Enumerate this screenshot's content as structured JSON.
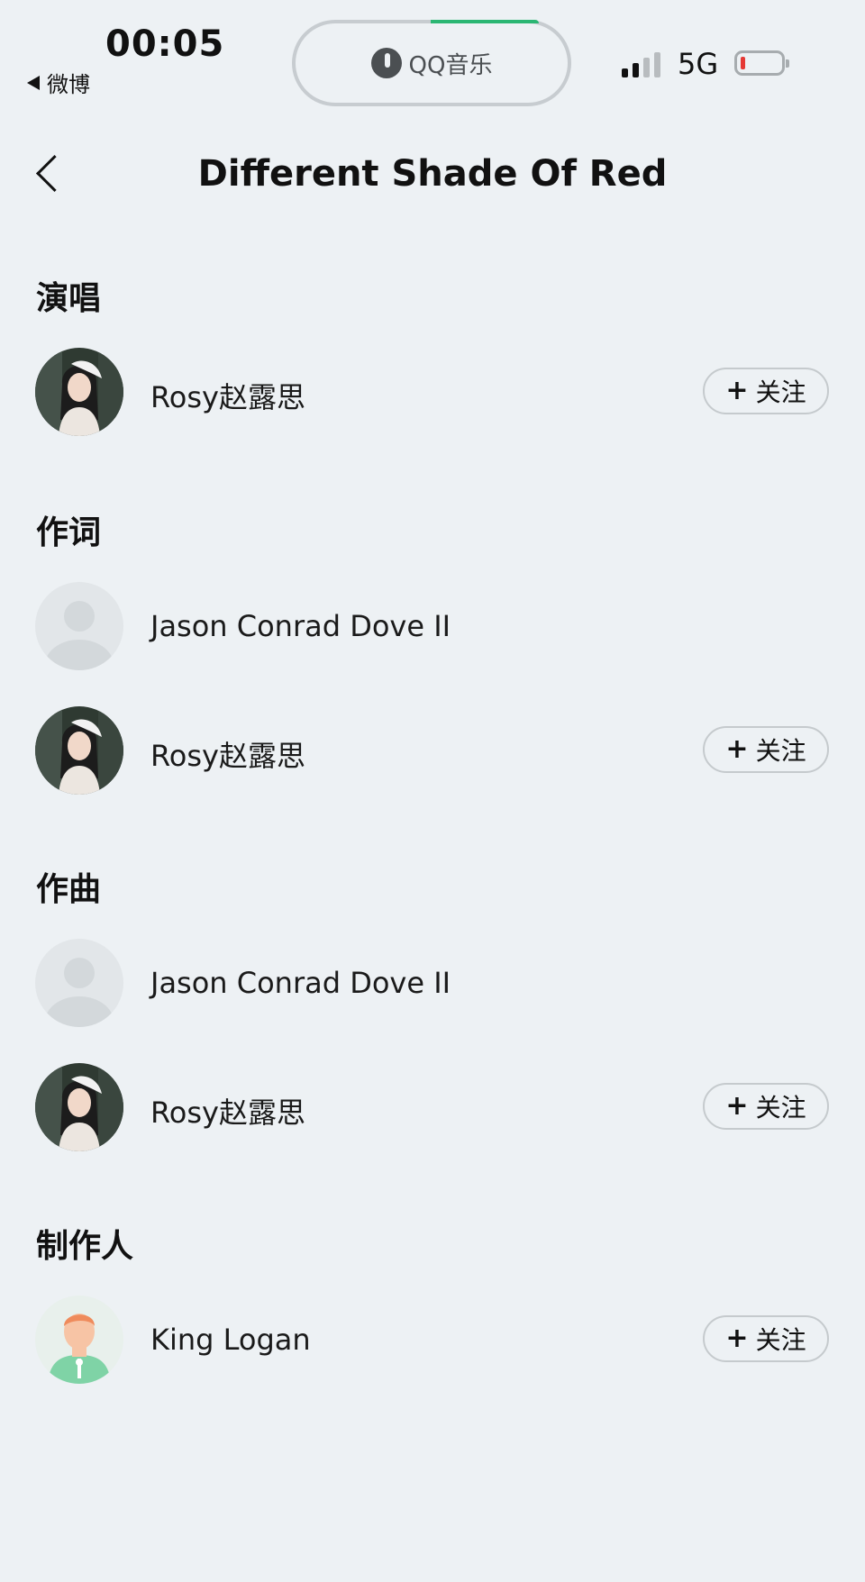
{
  "status_bar": {
    "time": "00:05",
    "back_app": "微博",
    "now_playing_app": "QQ音乐",
    "network": "5G",
    "battery_color": "#e53935",
    "progress_color": "#2bb673"
  },
  "header": {
    "title": "Different Shade Of Red"
  },
  "follow_label": "关注",
  "follow_plus": "+",
  "sections": {
    "singer": {
      "title": "演唱",
      "people": [
        {
          "name": "Rosy赵露思",
          "avatar": "photo",
          "follow": true
        }
      ]
    },
    "lyricist": {
      "title": "作词",
      "people": [
        {
          "name": "Jason Conrad Dove II",
          "avatar": "placeholder",
          "follow": false
        },
        {
          "name": "Rosy赵露思",
          "avatar": "photo",
          "follow": true
        }
      ]
    },
    "composer": {
      "title": "作曲",
      "people": [
        {
          "name": "Jason Conrad Dove II",
          "avatar": "placeholder",
          "follow": false
        },
        {
          "name": "Rosy赵露思",
          "avatar": "photo",
          "follow": true
        }
      ]
    },
    "producer": {
      "title": "制作人",
      "people": [
        {
          "name": "King Logan",
          "avatar": "illustration",
          "follow": true
        }
      ]
    }
  }
}
